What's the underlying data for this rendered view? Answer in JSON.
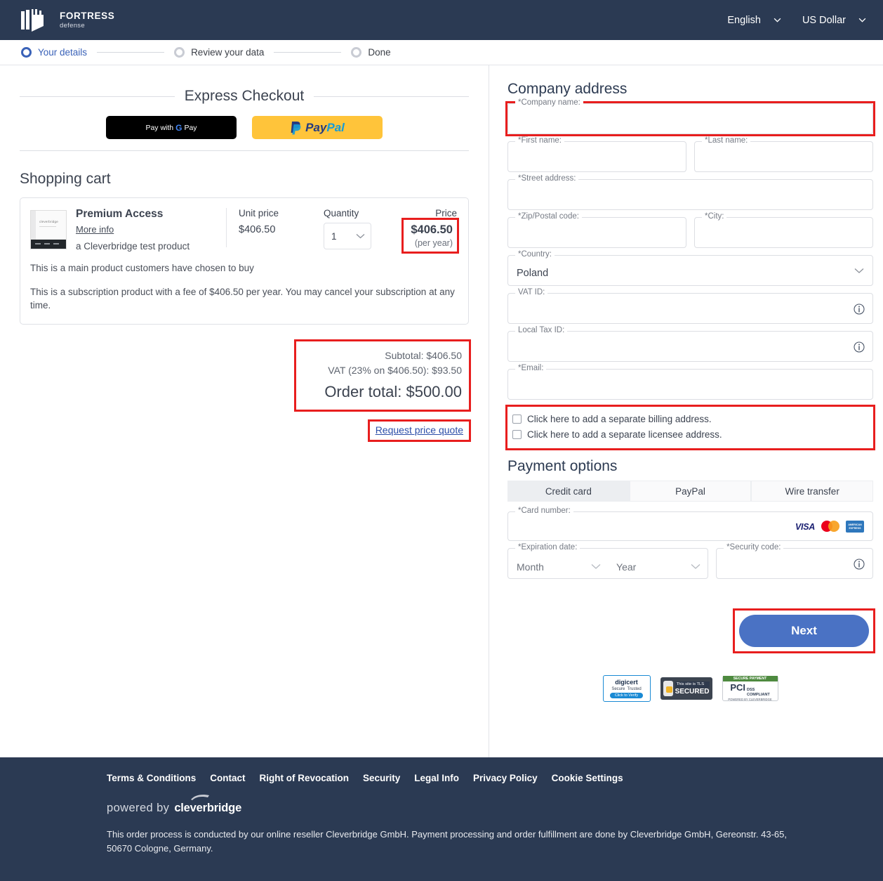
{
  "header": {
    "brand_name": "FORTRESS",
    "brand_sub": "defense",
    "language": "English",
    "currency": "US Dollar",
    "accent_color": "#2b3a53"
  },
  "steps": [
    {
      "label": "Your details",
      "state": "active"
    },
    {
      "label": "Review your data",
      "state": "inactive"
    },
    {
      "label": "Done",
      "state": "inactive"
    }
  ],
  "express": {
    "title": "Express Checkout",
    "gpay_label": "Pay with",
    "gpay_g": "G",
    "gpay_pay": "Pay",
    "paypal_pay": "Pay",
    "paypal_pal": "Pal"
  },
  "cart": {
    "title": "Shopping cart",
    "columns": {
      "unit_price": "Unit price",
      "quantity": "Quantity",
      "price": "Price"
    },
    "item": {
      "name": "Premium Access",
      "more_info": "More info",
      "subtitle": "a Cleverbridge test product",
      "thumb_logo": "cleverbridge",
      "unit_price": "$406.50",
      "quantity": "1",
      "price": "$406.50",
      "price_period": "(per year)",
      "desc_1": "This is a main product customers have chosen to buy",
      "desc_2": "This is a subscription product with a fee of $406.50 per year. You may cancel your subscription at any time."
    },
    "subtotal": "Subtotal: $406.50",
    "vat": "VAT (23% on $406.50): $93.50",
    "order_total": "Order total: $500.00",
    "request_quote": "Request price quote"
  },
  "company_address": {
    "title": "Company address",
    "fields": {
      "company_name": {
        "label": "*Company name:",
        "value": ""
      },
      "first_name": {
        "label": "*First name:",
        "value": ""
      },
      "last_name": {
        "label": "*Last name:",
        "value": ""
      },
      "street_address": {
        "label": "*Street address:",
        "value": ""
      },
      "zip": {
        "label": "*Zip/Postal code:",
        "value": ""
      },
      "city": {
        "label": "*City:",
        "value": ""
      },
      "country": {
        "label": "*Country:",
        "value": "Poland"
      },
      "vat_id": {
        "label": "VAT ID:",
        "value": ""
      },
      "local_tax_id": {
        "label": "Local Tax ID:",
        "value": ""
      },
      "email": {
        "label": "*Email:",
        "value": ""
      }
    },
    "checkboxes": [
      {
        "label": "Click here to add a separate billing address.",
        "checked": false
      },
      {
        "label": "Click here to add a separate licensee address.",
        "checked": false
      }
    ]
  },
  "payment": {
    "title": "Payment options",
    "tabs": [
      {
        "label": "Credit card",
        "active": true
      },
      {
        "label": "PayPal",
        "active": false
      },
      {
        "label": "Wire transfer",
        "active": false
      }
    ],
    "card_number": {
      "label": "*Card number:",
      "value": ""
    },
    "expiration": {
      "label": "*Expiration date:",
      "month": "Month",
      "year": "Year"
    },
    "security_code": {
      "label": "*Security code:",
      "value": ""
    },
    "brands": [
      "VISA",
      "mastercard",
      "american express"
    ],
    "next_label": "Next"
  },
  "badges": {
    "digicert": {
      "top": "digicert",
      "mid": "Secure \u0001 Trusted",
      "bottom": "Click to Verify"
    },
    "tls": {
      "line1": "This site is TLS",
      "line2": "SECURED"
    },
    "pci": {
      "top": "SECURE PAYMENT",
      "p": "PCI",
      "d1": "DSS",
      "d2": "COMPLIANT",
      "bottom": "POWERED BY CLEVERBRIDGE"
    }
  },
  "footer": {
    "links": [
      "Terms & Conditions",
      "Contact",
      "Right of Revocation",
      "Security",
      "Legal Info",
      "Privacy Policy",
      "Cookie Settings"
    ],
    "powered_by": "powered by",
    "powered_brand": "cleverbridge",
    "note": "This order process is conducted by our online reseller Cleverbridge GmbH. Payment processing and order fulfillment are done by Cleverbridge GmbH, Gereonstr. 43-65, 50670 Cologne, Germany."
  }
}
